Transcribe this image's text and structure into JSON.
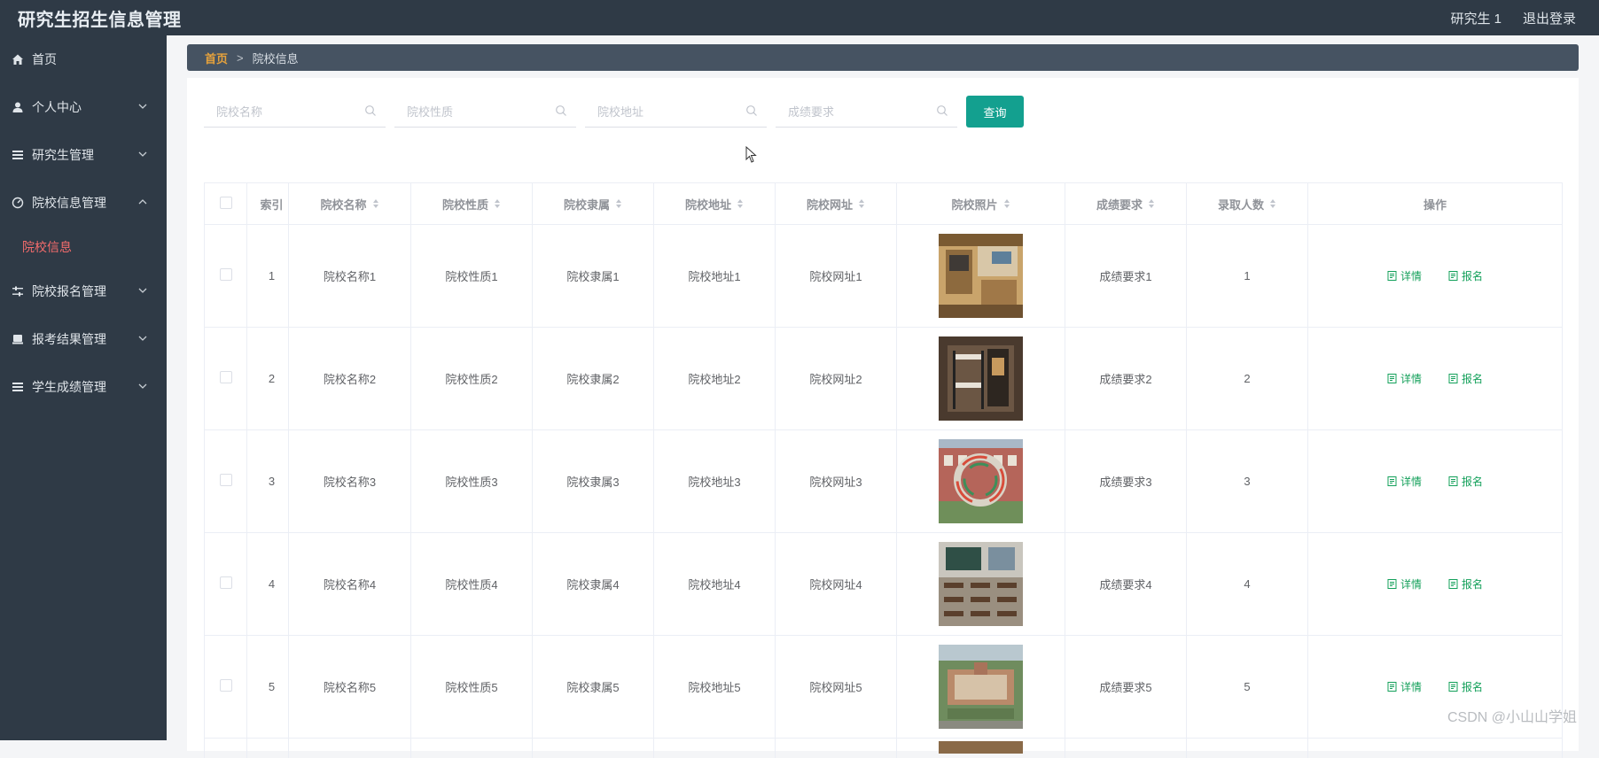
{
  "app": {
    "title": "研究生招生信息管理",
    "user": "研究生 1",
    "logout": "退出登录"
  },
  "sidebar": {
    "items": [
      {
        "label": "首页",
        "icon": "home-icon"
      },
      {
        "label": "个人中心",
        "icon": "user-icon"
      },
      {
        "label": "研究生管理",
        "icon": "list-icon"
      },
      {
        "label": "院校信息管理",
        "icon": "dashboard-icon"
      },
      {
        "label": "院校报名管理",
        "icon": "sliders-icon"
      },
      {
        "label": "报考结果管理",
        "icon": "printer-icon"
      },
      {
        "label": "学生成绩管理",
        "icon": "list-icon"
      }
    ],
    "active_sub": "院校信息"
  },
  "breadcrumb": {
    "home": "首页",
    "sep": ">",
    "current": "院校信息"
  },
  "search": {
    "fields": [
      {
        "placeholder": "院校名称"
      },
      {
        "placeholder": "院校性质"
      },
      {
        "placeholder": "院校地址"
      },
      {
        "placeholder": "成绩要求"
      }
    ],
    "button": "查询"
  },
  "table": {
    "headers": [
      "索引",
      "院校名称",
      "院校性质",
      "院校隶属",
      "院校地址",
      "院校网址",
      "院校照片",
      "成绩要求",
      "录取人数",
      "操作"
    ],
    "rows": [
      {
        "index": "1",
        "name": "院校名称1",
        "nature": "院校性质1",
        "affiliation": "院校隶属1",
        "address": "院校地址1",
        "website": "院校网址1",
        "photo": "dorm-room-photo",
        "requirement": "成绩要求1",
        "admitted": "1"
      },
      {
        "index": "2",
        "name": "院校名称2",
        "nature": "院校性质2",
        "affiliation": "院校隶属2",
        "address": "院校地址2",
        "website": "院校网址2",
        "photo": "bunk-bed-photo",
        "requirement": "成绩要求2",
        "admitted": "2"
      },
      {
        "index": "3",
        "name": "院校名称3",
        "nature": "院校性质3",
        "affiliation": "院校隶属3",
        "address": "院校地址3",
        "website": "院校网址3",
        "photo": "campus-sculpture-photo",
        "requirement": "成绩要求3",
        "admitted": "3"
      },
      {
        "index": "4",
        "name": "院校名称4",
        "nature": "院校性质4",
        "affiliation": "院校隶属4",
        "address": "院校地址4",
        "website": "院校网址4",
        "photo": "classroom-photo",
        "requirement": "成绩要求4",
        "admitted": "4"
      },
      {
        "index": "5",
        "name": "院校名称5",
        "nature": "院校性质5",
        "affiliation": "院校隶属5",
        "address": "院校地址5",
        "website": "院校网址5",
        "photo": "campus-aerial-photo",
        "requirement": "成绩要求5",
        "admitted": "5"
      }
    ],
    "actions": {
      "detail": "详情",
      "apply": "报名"
    }
  },
  "watermark": "CSDN @小山山学姐",
  "colors": {
    "sidebar_bg": "#2f3a46",
    "accent": "#13a08f",
    "active_sub": "#f56c6c",
    "action_green": "#13a05a"
  }
}
